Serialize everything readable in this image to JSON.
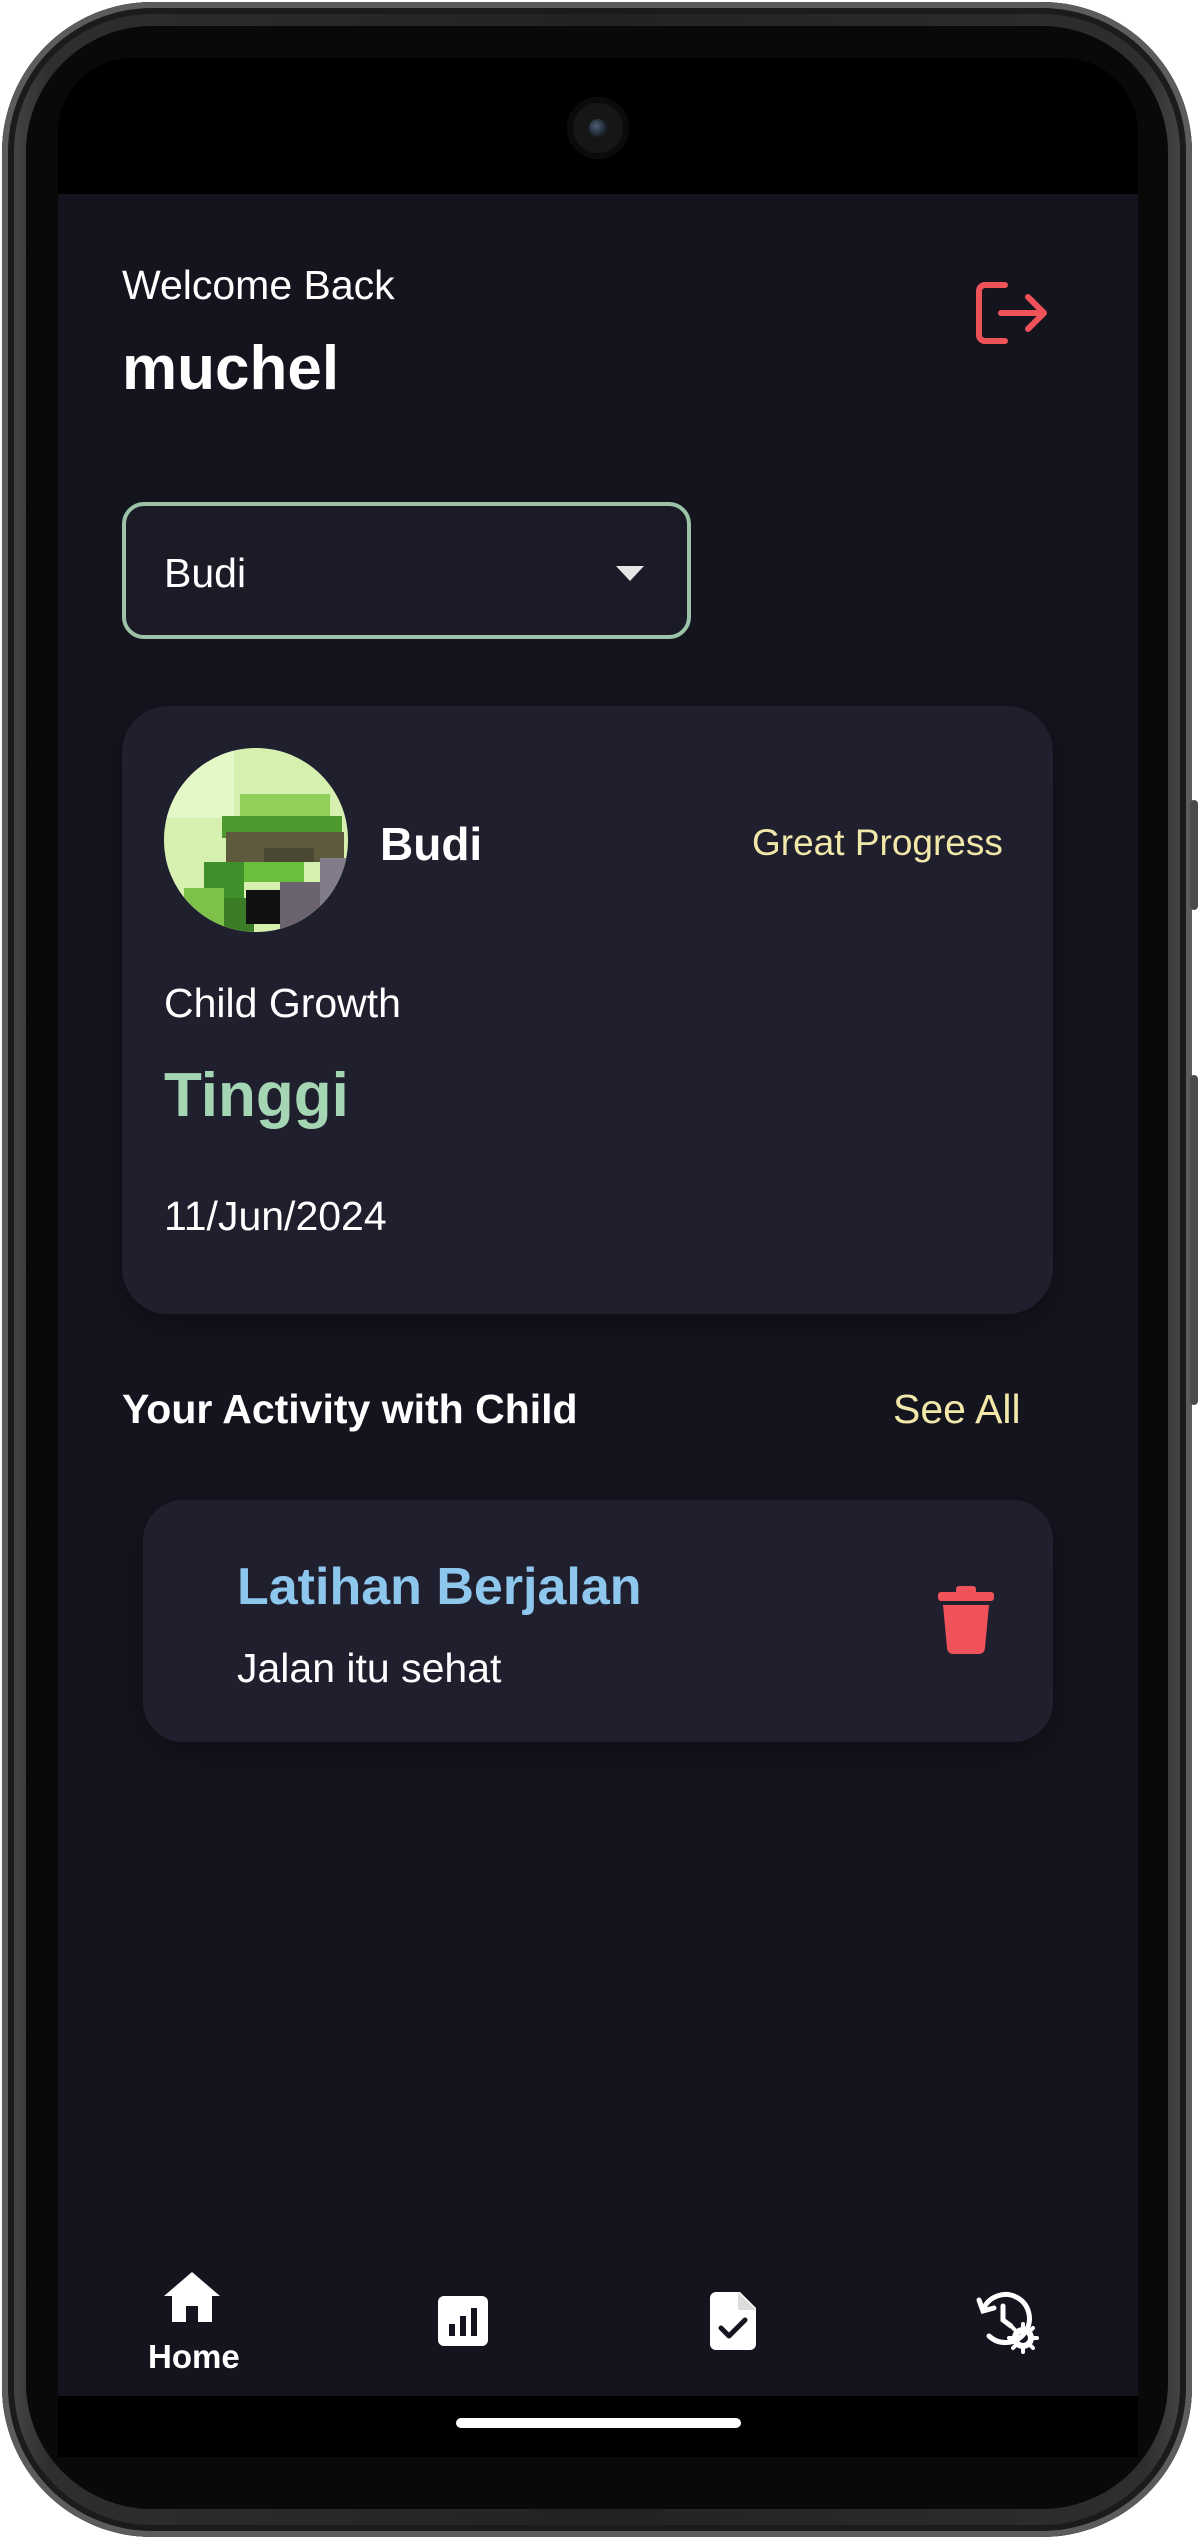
{
  "header": {
    "greeting": "Welcome Back",
    "username": "muchel"
  },
  "child_select": {
    "selected": "Budi"
  },
  "child_card": {
    "name": "Budi",
    "badge": "Great Progress",
    "growth_label": "Child Growth",
    "growth_value": "Tinggi",
    "date": "11/Jun/2024"
  },
  "activity_section": {
    "title": "Your Activity with Child",
    "see_all": "See All",
    "items": [
      {
        "title": "Latihan Berjalan",
        "description": "Jalan itu sehat"
      }
    ]
  },
  "bottom_nav": {
    "items": [
      {
        "label": "Home",
        "icon": "home-icon",
        "active": true
      },
      {
        "label": "",
        "icon": "chart-icon",
        "active": false
      },
      {
        "label": "",
        "icon": "report-check-icon",
        "active": false
      },
      {
        "label": "",
        "icon": "history-settings-icon",
        "active": false
      }
    ]
  },
  "colors": {
    "background": "#14141f",
    "card": "#1f1f2e",
    "accent_green": "#a5d6b4",
    "accent_yellow": "#f1e7a9",
    "accent_blue": "#8ec7ee",
    "danger": "#f0525a"
  }
}
